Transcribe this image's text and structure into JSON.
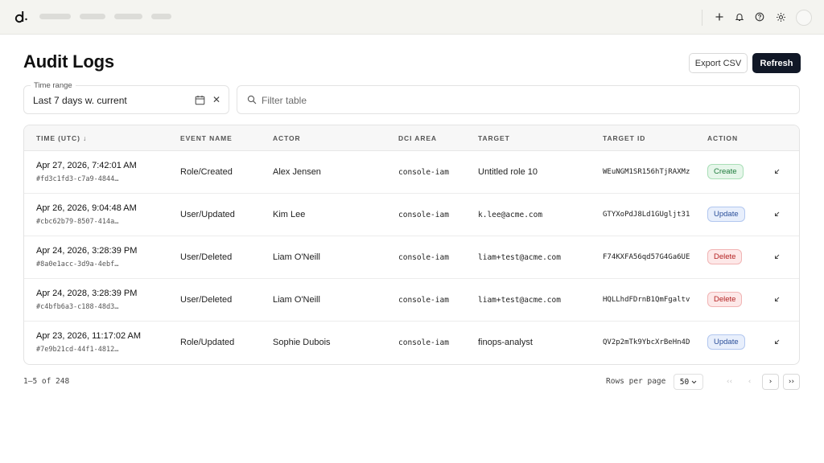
{
  "header": {
    "title": "Audit Logs",
    "export_label": "Export CSV",
    "refresh_label": "Refresh"
  },
  "filters": {
    "time_range_label": "Time range",
    "time_range_value": "Last 7 days w. current",
    "filter_placeholder": "Filter table"
  },
  "table": {
    "columns": [
      "TIME (UTC) ↓",
      "EVENT NAME",
      "ACTOR",
      "DCI AREA",
      "TARGET",
      "TARGET ID",
      "ACTION"
    ],
    "rows": [
      {
        "time": "Apr 27, 2026, 7:42:01 AM",
        "id": "#fd3c1fd3-c7a9-4844…",
        "event": "Role/Created",
        "actor": "Alex Jensen",
        "area": "console-iam",
        "target": "Untitled role 10",
        "target_id": "WEuNGM1SR156hTjRAXMz",
        "action": "Create"
      },
      {
        "time": "Apr 26, 2026, 9:04:48 AM",
        "id": "#cbc62b79-8507-414a…",
        "event": "User/Updated",
        "actor": "Kim Lee",
        "area": "console-iam",
        "target": "k.lee@acme.com",
        "target_id": "GTYXoPdJ8Ld1GUgljt31",
        "action": "Update"
      },
      {
        "time": "Apr 24, 2026, 3:28:39 PM",
        "id": "#8a0e1acc-3d9a-4ebf…",
        "event": "User/Deleted",
        "actor": "Liam O'Neill",
        "area": "console-iam",
        "target": "liam+test@acme.com",
        "target_id": "F74KXFA56qd57G4Ga6UE",
        "action": "Delete"
      },
      {
        "time": "Apr 24, 2028, 3:28:39 PM",
        "id": "#c4bfb6a3-c188-48d3…",
        "event": "User/Deleted",
        "actor": "Liam O'Neill",
        "area": "console-iam",
        "target": "liam+test@acme.com",
        "target_id": "HQLLhdFDrnB1QmFgaltv",
        "action": "Delete"
      },
      {
        "time": "Apr 23, 2026, 11:17:02 AM",
        "id": "#7e9b21cd-44f1-4812…",
        "event": "Role/Updated",
        "actor": "Sophie Dubois",
        "area": "console-iam",
        "target": "finops-analyst",
        "target_id": "QV2p2mTk9YbcXrBeHn4D",
        "action": "Update"
      }
    ]
  },
  "badge_colors": {
    "Create": {
      "bg": "#e6f6ea",
      "fg": "#1e7b3c",
      "border": "#a9dfb7"
    },
    "Update": {
      "bg": "#e8effc",
      "fg": "#2b4f9a",
      "border": "#b2c7ef"
    },
    "Delete": {
      "bg": "#fde8e8",
      "fg": "#b42323",
      "border": "#f1b4b4"
    }
  },
  "footer": {
    "range_text": "1–5 of 248",
    "rows_per_page_label": "Rows per page",
    "rows_per_page_value": "50"
  },
  "icons": [
    "logo-icon",
    "plus-icon",
    "bell-icon",
    "help-icon",
    "settings-icon",
    "calendar-icon",
    "close-icon",
    "search-icon",
    "expand-row-icon",
    "chevron-down-icon"
  ]
}
